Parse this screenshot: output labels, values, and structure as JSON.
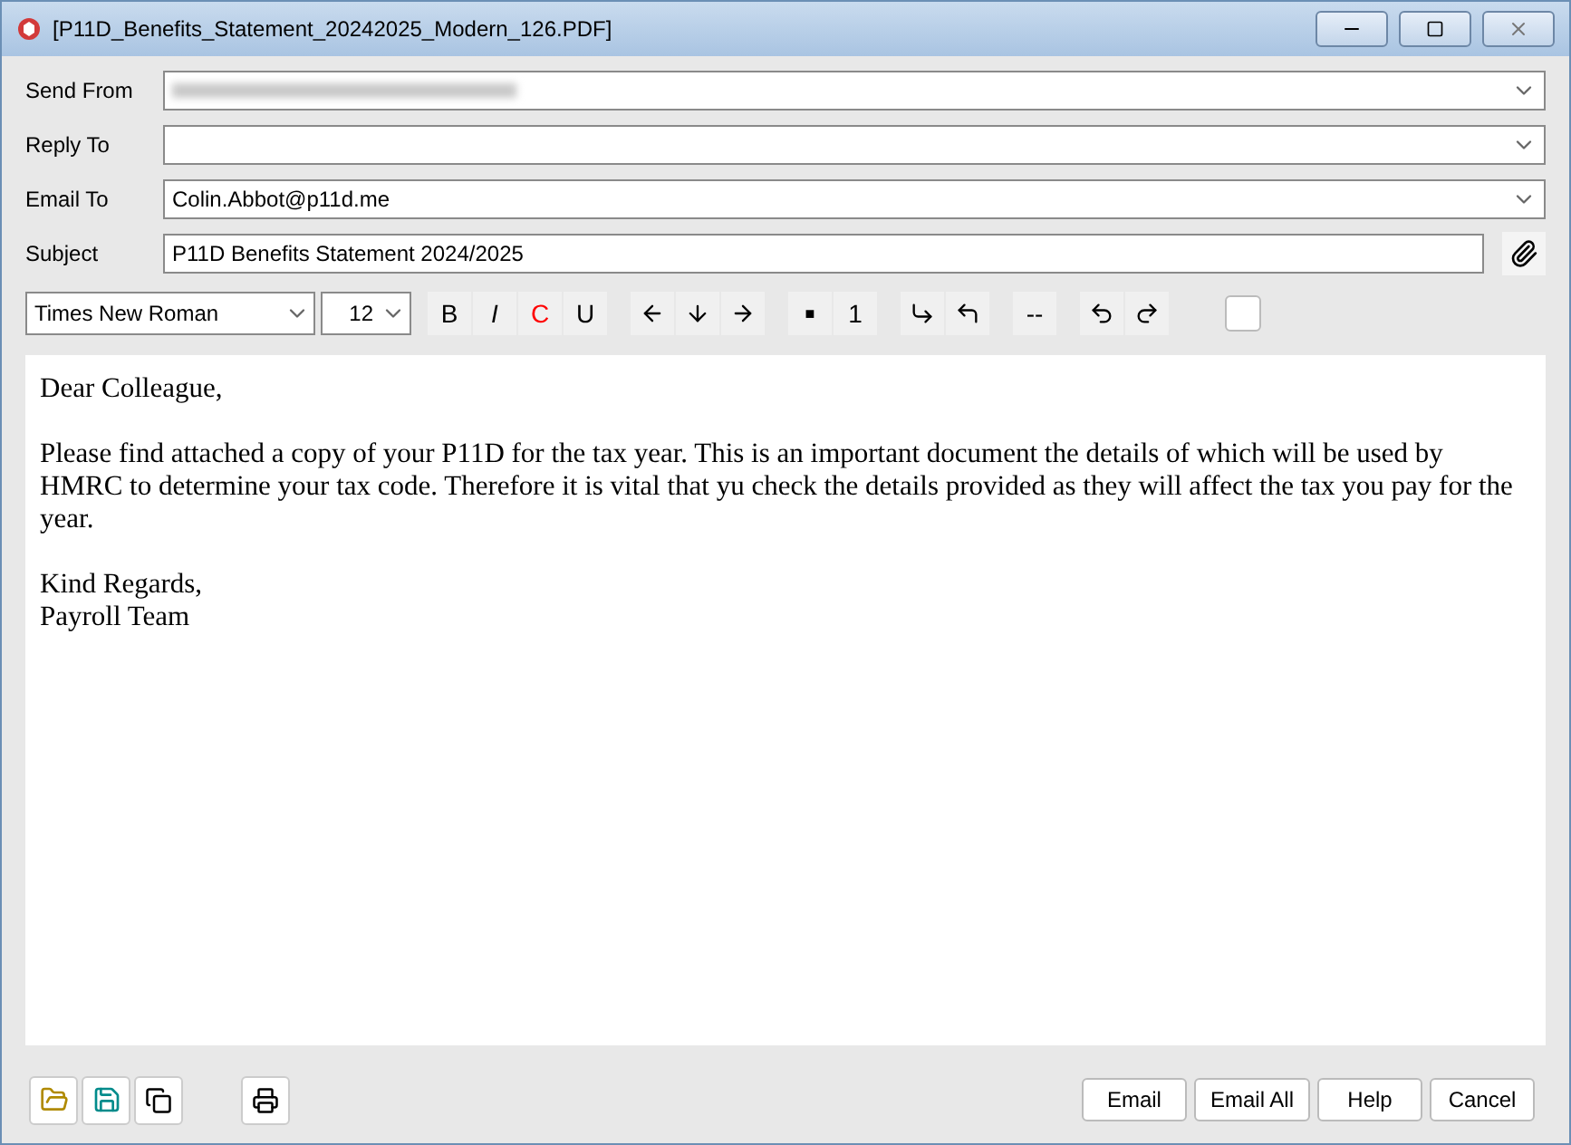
{
  "window": {
    "title": "[P11D_Benefits_Statement_20242025_Modern_126.PDF]"
  },
  "fields": [
    {
      "label": "Send From",
      "blurred": true,
      "kind": "combo"
    },
    {
      "label": "Reply To",
      "blurred": false,
      "kind": "combo"
    },
    {
      "label": "Email To",
      "value": "Colin.Abbot@p11d.me",
      "blurred": false,
      "kind": "combo"
    },
    {
      "label": "Subject",
      "value": "P11D Benefits Statement 2024/2025",
      "blurred": false,
      "kind": "text"
    }
  ],
  "toolbar": {
    "font": "Times New Roman",
    "size": "12",
    "format_buttons": [
      {
        "label": "B",
        "color": "#000000"
      },
      {
        "label": "I",
        "color": "#000000"
      },
      {
        "label": "C",
        "color": "#ff0000"
      },
      {
        "label": "U",
        "color": "#000000"
      }
    ],
    "list_buttons": [
      "■",
      "1"
    ],
    "rule_button": "--"
  },
  "body": [
    "Dear Colleague,",
    "Please find attached a copy of your P11D for the tax year. This is an important document the details of which will be used by HMRC to determine your tax code. Therefore it is vital that yu check the details provided as they will affect the tax you pay for the year.",
    "Kind Regards,\nPayroll Team"
  ],
  "buttons": [
    "Email",
    "Email All",
    "Help",
    "Cancel"
  ]
}
